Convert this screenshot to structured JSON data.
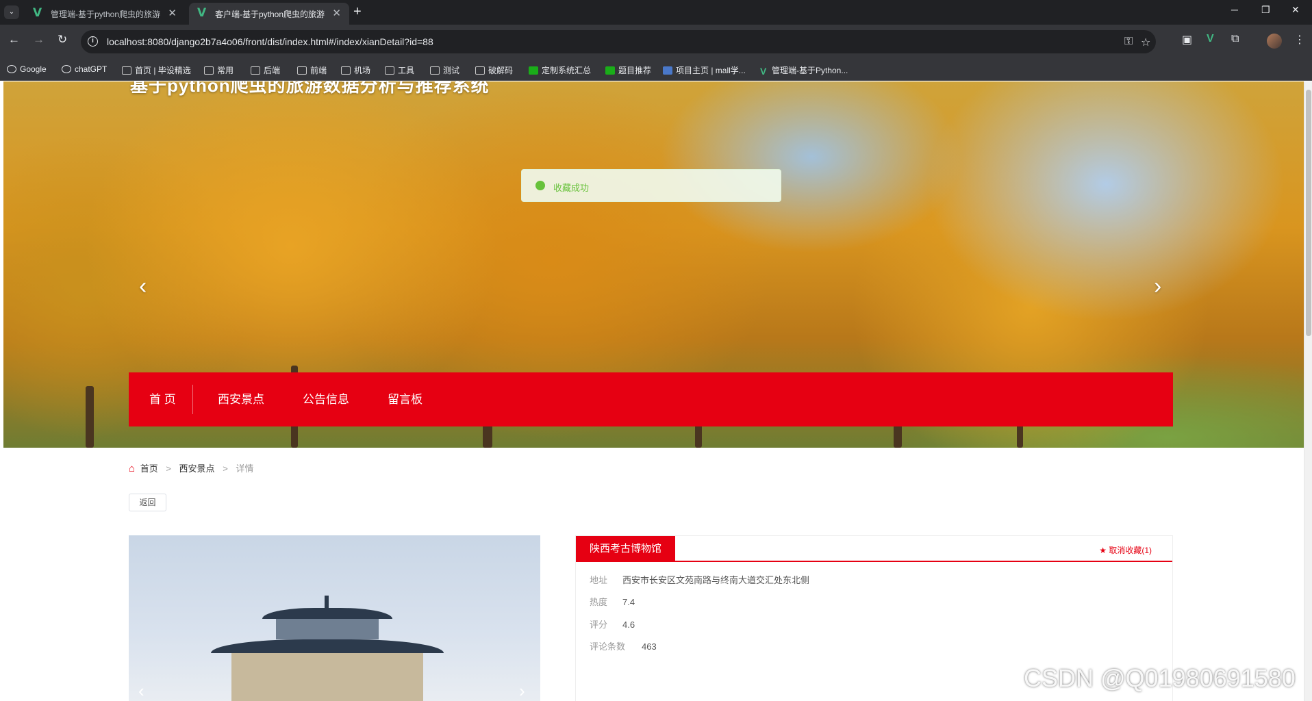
{
  "browser": {
    "tabs": [
      {
        "title": "管理端-基于python爬虫的旅游",
        "active": false
      },
      {
        "title": "客户端-基于python爬虫的旅游",
        "active": true
      }
    ],
    "url": "localhost:8080/django2b7a4o06/front/dist/index.html#/index/xianDetail?id=88",
    "bookmarks": [
      {
        "label": "Google",
        "icon": "google-icon"
      },
      {
        "label": "chatGPT",
        "icon": "chatgpt-icon"
      },
      {
        "label": "首页 | 毕设精选",
        "icon": "site-icon"
      },
      {
        "label": "常用",
        "icon": "folder-icon"
      },
      {
        "label": "后端",
        "icon": "folder-icon"
      },
      {
        "label": "前端",
        "icon": "folder-icon"
      },
      {
        "label": "机场",
        "icon": "folder-icon"
      },
      {
        "label": "工具",
        "icon": "folder-icon"
      },
      {
        "label": "测试",
        "icon": "folder-icon"
      },
      {
        "label": "破解码",
        "icon": "folder-icon"
      },
      {
        "label": "定制系统汇总",
        "icon": "sheet-icon"
      },
      {
        "label": "题目推荐",
        "icon": "sheet-icon"
      },
      {
        "label": "项目主页 | mall学...",
        "icon": "doc-icon"
      },
      {
        "label": "管理端-基于Python...",
        "icon": "vue-icon"
      }
    ]
  },
  "page": {
    "site_title": "基于python爬虫的旅游数据分析与推荐系统",
    "toast": "收藏成功",
    "nav": [
      "首 页",
      "西安景点",
      "公告信息",
      "留言板"
    ],
    "breadcrumb": {
      "home": "首页",
      "section": "西安景点",
      "current": "详情",
      "sep": ">"
    },
    "back_button": "返回",
    "detail": {
      "name": "陕西考古博物馆",
      "favorite_action": "取消收藏(1)",
      "fields": [
        {
          "label": "地址",
          "value": "西安市长安区文苑南路与终南大道交汇处东北侧"
        },
        {
          "label": "热度",
          "value": "7.4"
        },
        {
          "label": "评分",
          "value": "4.6"
        },
        {
          "label": "评论条数",
          "value": "463"
        }
      ]
    },
    "watermark": "CSDN @Q01980691580"
  },
  "colors": {
    "primary_red": "#e60012",
    "success_green": "#67c23a"
  }
}
